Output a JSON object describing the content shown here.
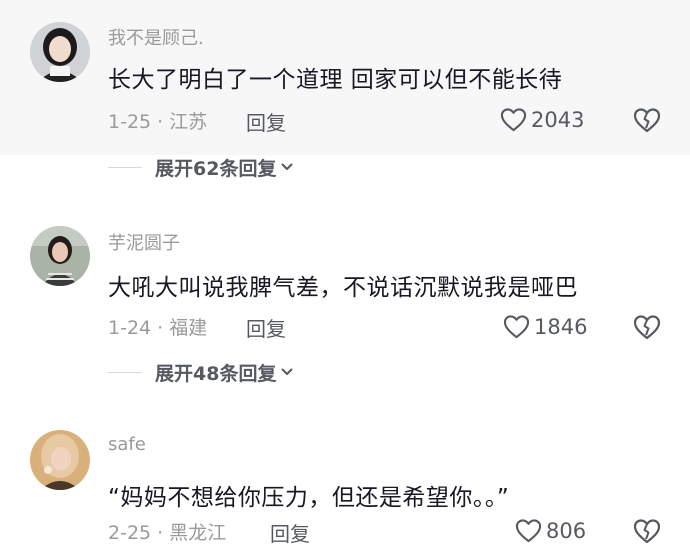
{
  "comments": [
    {
      "username": "我不是顾己.",
      "content": "长大了明白了一个道理 回家可以但不能长待",
      "meta": "1-25 · 江苏",
      "reply_label": "回复",
      "likes": "2043",
      "avatar": {
        "bg": "#cfd3d6",
        "hair": "#1c1a1a",
        "skin": "#f2dccd",
        "clothes": "#222222"
      }
    },
    {
      "username": "芋泥圆子",
      "content": "大吼大叫说我脾气差，不说话沉默说我是哑巴",
      "meta": "1-24 · 福建",
      "reply_label": "回复",
      "likes": "1846",
      "avatar": {
        "bg": "#a9b3a6",
        "hair": "#231d1a",
        "skin": "#e8c9b6",
        "clothes": "#3b3b3b"
      }
    },
    {
      "username": "safe",
      "content": "“妈妈不想给你压力，但还是希望你。。”",
      "meta": "2-25 · 黑龙江",
      "reply_label": "回复",
      "likes": "806",
      "avatar": {
        "bg": "#d9b07a",
        "hair": "#e7c9a3",
        "skin": "#f1d3c1",
        "clothes": "#4a3728"
      }
    }
  ],
  "expand_replies": [
    {
      "label": "展开62条回复"
    },
    {
      "label": "展开48条回复"
    }
  ],
  "icons": {
    "like": "heart-outline-icon",
    "dislike": "broken-heart-icon",
    "expand": "chevron-down-icon"
  }
}
